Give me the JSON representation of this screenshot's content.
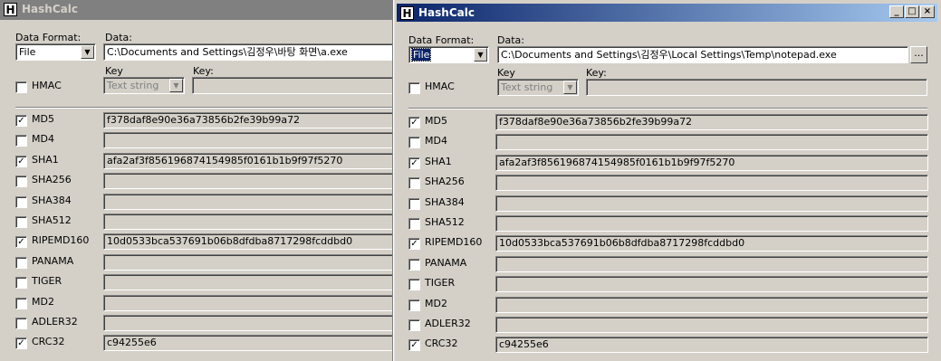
{
  "app": {
    "title": "HashCalc",
    "icon": "H"
  },
  "labels": {
    "data_format": "Data Format:",
    "data": "Data:",
    "key_format": "Key",
    "key": "Key:",
    "hmac": "HMAC"
  },
  "windows": {
    "left": {
      "data_format_value": "File",
      "data_value": "C:\\Documents and Settings\\김정우\\바탕 화면\\a.exe",
      "key_format_value": "Text string",
      "hashes": [
        {
          "label": "MD5",
          "checked": true,
          "value": "f378daf8e90e36a73856b2fe39b99a72"
        },
        {
          "label": "MD4",
          "checked": false,
          "value": ""
        },
        {
          "label": "SHA1",
          "checked": true,
          "value": "afa2af3f856196874154985f0161b1b9f97f5270"
        },
        {
          "label": "SHA256",
          "checked": false,
          "value": ""
        },
        {
          "label": "SHA384",
          "checked": false,
          "value": ""
        },
        {
          "label": "SHA512",
          "checked": false,
          "value": ""
        },
        {
          "label": "RIPEMD160",
          "checked": true,
          "value": "10d0533bca537691b06b8dfdba8717298fcddbd0"
        },
        {
          "label": "PANAMA",
          "checked": false,
          "value": ""
        },
        {
          "label": "TIGER",
          "checked": false,
          "value": ""
        },
        {
          "label": "MD2",
          "checked": false,
          "value": ""
        },
        {
          "label": "ADLER32",
          "checked": false,
          "value": ""
        },
        {
          "label": "CRC32",
          "checked": true,
          "value": "c94255e6"
        }
      ]
    },
    "right": {
      "data_format_value": "File",
      "data_value": "C:\\Documents and Settings\\김정우\\Local Settings\\Temp\\notepad.exe",
      "key_format_value": "Text string",
      "browse_label": "...",
      "hashes": [
        {
          "label": "MD5",
          "checked": true,
          "value": "f378daf8e90e36a73856b2fe39b99a72"
        },
        {
          "label": "MD4",
          "checked": false,
          "value": ""
        },
        {
          "label": "SHA1",
          "checked": true,
          "value": "afa2af3f856196874154985f0161b1b9f97f5270"
        },
        {
          "label": "SHA256",
          "checked": false,
          "value": ""
        },
        {
          "label": "SHA384",
          "checked": false,
          "value": ""
        },
        {
          "label": "SHA512",
          "checked": false,
          "value": ""
        },
        {
          "label": "RIPEMD160",
          "checked": true,
          "value": "10d0533bca537691b06b8dfdba8717298fcddbd0"
        },
        {
          "label": "PANAMA",
          "checked": false,
          "value": ""
        },
        {
          "label": "TIGER",
          "checked": false,
          "value": ""
        },
        {
          "label": "MD2",
          "checked": false,
          "value": ""
        },
        {
          "label": "ADLER32",
          "checked": false,
          "value": ""
        },
        {
          "label": "CRC32",
          "checked": true,
          "value": "c94255e6"
        }
      ]
    }
  },
  "colors": {
    "dialog": "#d4d0c8",
    "active_title": "#0a246a",
    "inactive_title": "#808080"
  }
}
